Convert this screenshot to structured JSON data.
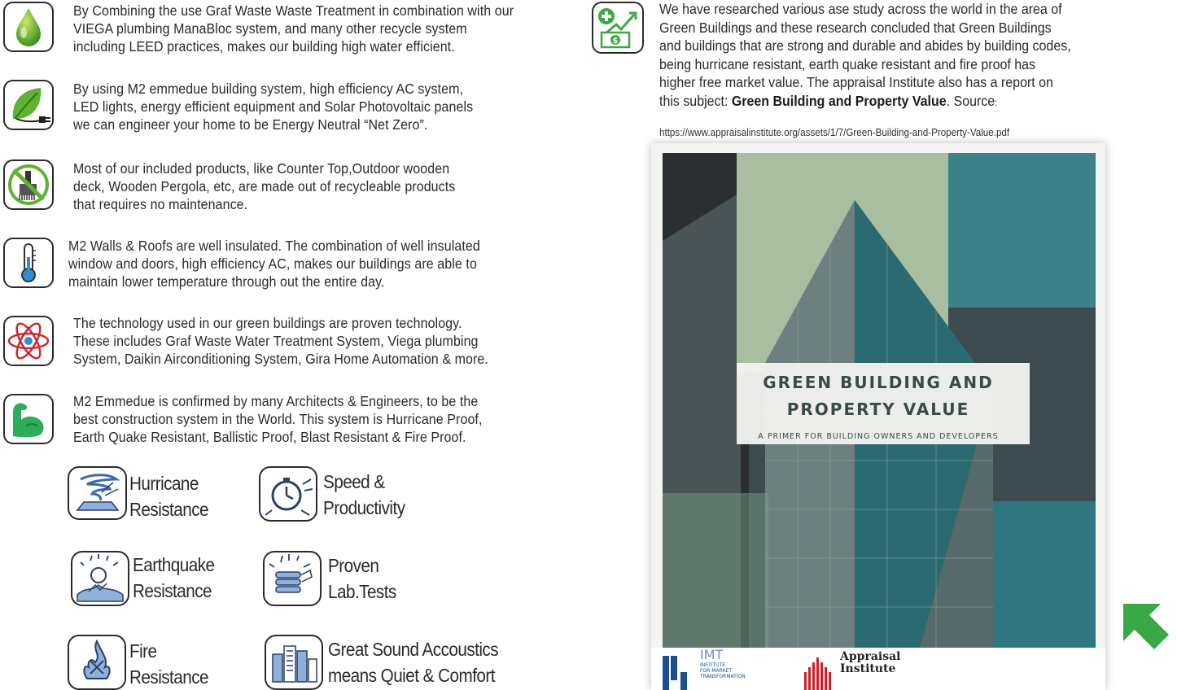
{
  "features": [
    {
      "icon": "water-drop-icon",
      "lines": [
        "By Combining the use Graf Waste Waste Treatment in combination with our",
        "VIEGA plumbing ManaBloc system, and many other recycle system",
        "including LEED practices, makes our building high water efficient."
      ]
    },
    {
      "icon": "leaf-plug-icon",
      "lines": [
        "By using M2 emmedue building system, high efficiency AC system,",
        "LED lights, energy efficient equipment and Solar Photovoltaic panels",
        "we can engineer your home to be Energy Neutral “Net Zero”."
      ]
    },
    {
      "icon": "no-paint-brush-icon",
      "lines": [
        "Most of our included products, like Counter Top,Outdoor wooden",
        "deck, Wooden Pergola, etc, are made out of recycleable products",
        "that requires no maintenance."
      ]
    },
    {
      "icon": "thermometer-icon",
      "lines": [
        "M2 Walls & Roofs are well insulated. The combination of well insulated",
        "window and doors, high efficiency AC, makes our buildings are able to",
        "maintain lower temperature through out the entire day."
      ]
    },
    {
      "icon": "atom-icon",
      "lines": [
        "The technology used in our green buildings are proven technology.",
        "These includes Graf Waste Water Treatment System, Viega plumbing",
        "System, Daikin Airconditioning System, Gira Home Automation & more."
      ]
    },
    {
      "icon": "strong-arm-icon",
      "lines": [
        "M2 Emmedue is confirmed by many Architects & Engineers, to be the",
        "best construction system in the World. This system is Hurricane Proof,",
        "Earth Quake Resistant, Ballistic Proof, Blast Resistant & Fire Proof."
      ]
    }
  ],
  "badges": [
    {
      "icon": "hurricane-icon",
      "lines": [
        "Hurricane",
        "Resistance"
      ]
    },
    {
      "icon": "stopwatch-icon",
      "lines": [
        "Speed &",
        "Productivity"
      ]
    },
    {
      "icon": "earthquake-icon",
      "lines": [
        "Earthquake",
        "Resistance"
      ]
    },
    {
      "icon": "lab-test-icon",
      "lines": [
        "Proven",
        "Lab.Tests"
      ]
    },
    {
      "icon": "fire-icon",
      "lines": [
        "Fire",
        "Resistance"
      ]
    },
    {
      "icon": "city-sound-icon",
      "lines": [
        "Great Sound Accoustics",
        "means Quiet & Comfort"
      ]
    }
  ],
  "value_section": {
    "icon": "money-growth-icon",
    "lines": [
      "We have researched various ase study across the world in the area of",
      "Green Buildings and these research concluded that Green Buildings",
      "and buildings that are strong and durable and abides by building codes,",
      "being hurricane resistant, earth quake resistant and fire proof has",
      "higher free market value. The appraisal Institute also has a report on"
    ],
    "last_prefix": "this subject: ",
    "report_title": "Green Building and Property Value",
    "last_suffix": ". Source",
    "colon": ":",
    "url": "https://www.appraisalinstitute.org/assets/1/7/Green-Building-and-Property-Value.pdf"
  },
  "cover": {
    "title_line1": "GREEN BUILDING AND",
    "title_line2": "PROPERTY VALUE",
    "subtitle": "A PRIMER FOR BUILDING OWNERS AND DEVELOPERS",
    "logo1_abbr": "IMT",
    "logo1_lines": [
      "INSTITUTE",
      "FOR MARKET",
      "TRANSFORMATION"
    ],
    "logo2_lines": [
      "Appraisal",
      "Institute"
    ]
  },
  "colors": {
    "accent_green": "#3aa845",
    "text": "#2a2a2a",
    "border": "#2b2b2b"
  },
  "nav": {
    "back_to_top_icon": "up-left-arrow-icon"
  }
}
